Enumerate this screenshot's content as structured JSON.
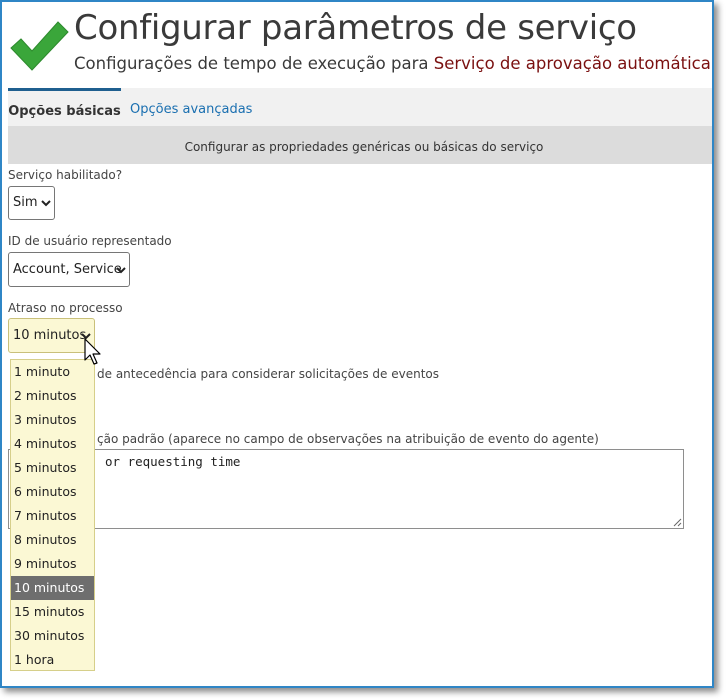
{
  "header": {
    "title": "Configurar parâmetros de serviço",
    "subtitle_prefix": "Configurações de tempo de execução para ",
    "service_name": "Serviço de aprovação automática",
    "icon": "checkmark-icon",
    "icon_color": "#3aa63a"
  },
  "tabs": [
    {
      "label": "Opções básicas",
      "active": true
    },
    {
      "label": "Opções avançadas",
      "active": false
    }
  ],
  "description": "Configurar as propriedades genéricas ou básicas do serviço",
  "fields": {
    "enabled": {
      "label": "Serviço habilitado?",
      "value": "Sim"
    },
    "user": {
      "label": "ID de usuário representado",
      "value": "Account, Service"
    },
    "delay": {
      "label": "Atraso no processo",
      "value": "10 minutos"
    }
  },
  "partial_labels": {
    "advance": "de antecedência para considerar solicitações de eventos",
    "note": "ção padrão (aparece no campo de observações na atribuição de evento do agente)"
  },
  "textarea_value": "or requesting time",
  "delay_options": [
    "1 minuto",
    "2 minutos",
    "3 minutos",
    "4 minutos",
    "5 minutos",
    "6 minutos",
    "7 minutos",
    "8 minutos",
    "9 minutos",
    "10 minutos",
    "15 minutos",
    "30 minutos",
    "1 hora"
  ],
  "delay_selected_index": 9,
  "colors": {
    "accent": "#1a6fb0",
    "service_name": "#7a1010",
    "dropdown_bg": "#fbf8d4",
    "selected_option": "#6e6e6e"
  }
}
